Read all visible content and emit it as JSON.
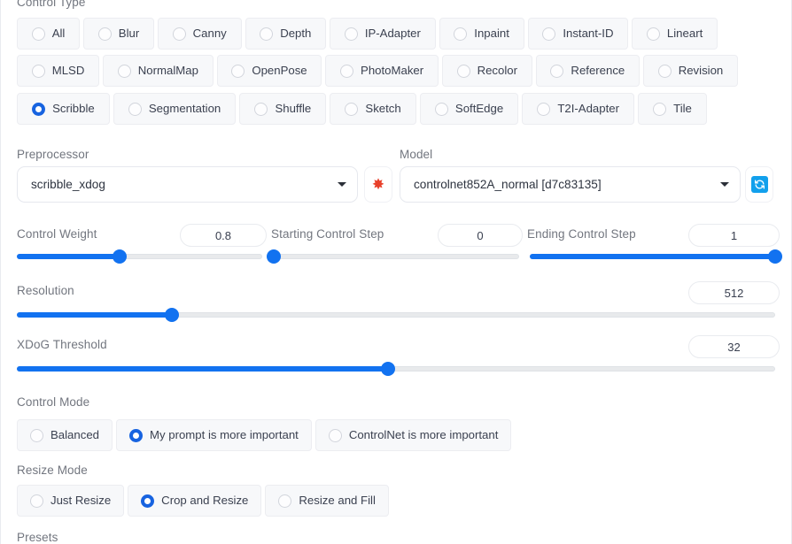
{
  "theme": {
    "accent_blue": "#1272f0",
    "radio_selected": "#1763e0",
    "refresh_chip": "#12a0ec",
    "pill_bg": "#f7f8fa",
    "label_gray": "#72767f",
    "text_dark": "#3b4150"
  },
  "control_type": {
    "label": "Control Type",
    "selected": "Scribble",
    "rows": [
      [
        {
          "label": "All",
          "selected": false
        },
        {
          "label": "Blur",
          "selected": false
        },
        {
          "label": "Canny",
          "selected": false
        },
        {
          "label": "Depth",
          "selected": false
        },
        {
          "label": "IP-Adapter",
          "selected": false
        },
        {
          "label": "Inpaint",
          "selected": false
        },
        {
          "label": "Instant-ID",
          "selected": false
        },
        {
          "label": "Lineart",
          "selected": false
        }
      ],
      [
        {
          "label": "MLSD",
          "selected": false
        },
        {
          "label": "NormalMap",
          "selected": false
        },
        {
          "label": "OpenPose",
          "selected": false
        },
        {
          "label": "PhotoMaker",
          "selected": false
        },
        {
          "label": "Recolor",
          "selected": false
        },
        {
          "label": "Reference",
          "selected": false
        },
        {
          "label": "Revision",
          "selected": false
        }
      ],
      [
        {
          "label": "Scribble",
          "selected": true
        },
        {
          "label": "Segmentation",
          "selected": false
        },
        {
          "label": "Shuffle",
          "selected": false
        },
        {
          "label": "Sketch",
          "selected": false
        },
        {
          "label": "SoftEdge",
          "selected": false
        },
        {
          "label": "T2I-Adapter",
          "selected": false
        },
        {
          "label": "Tile",
          "selected": false
        }
      ]
    ]
  },
  "preprocessor": {
    "label": "Preprocessor",
    "value": "scribble_xdog",
    "caret_icon": "chevron-down-icon",
    "action_icon": "boom-star-icon",
    "action_glyph": "✸"
  },
  "model": {
    "label": "Model",
    "value": "controlnet852A_normal [d7c83135]",
    "caret_icon": "chevron-down-icon",
    "action_icon": "refresh-icon",
    "action_glyph": "↻"
  },
  "sliders": {
    "control_weight": {
      "label": "Control Weight",
      "value": "0.8",
      "min": 0,
      "max": 2,
      "fill_pct": 42
    },
    "starting_control_step": {
      "label": "Starting Control Step",
      "value": "0",
      "min": 0,
      "max": 1,
      "fill_pct": 0
    },
    "ending_control_step": {
      "label": "Ending Control Step",
      "value": "1",
      "min": 0,
      "max": 1,
      "fill_pct": 100
    },
    "resolution": {
      "label": "Resolution",
      "value": "512",
      "min": 64,
      "max": 2048,
      "fill_pct": 20.5
    },
    "xdog_threshold": {
      "label": "XDoG Threshold",
      "value": "32",
      "min": 1,
      "max": 64,
      "fill_pct": 49
    }
  },
  "control_mode": {
    "label": "Control Mode",
    "selected": "My prompt is more important",
    "options": [
      {
        "label": "Balanced",
        "selected": false
      },
      {
        "label": "My prompt is more important",
        "selected": true
      },
      {
        "label": "ControlNet is more important",
        "selected": false
      }
    ]
  },
  "resize_mode": {
    "label": "Resize Mode",
    "selected": "Crop and Resize",
    "options": [
      {
        "label": "Just Resize",
        "selected": false
      },
      {
        "label": "Crop and Resize",
        "selected": true
      },
      {
        "label": "Resize and Fill",
        "selected": false
      }
    ]
  },
  "presets": {
    "label": "Presets"
  }
}
